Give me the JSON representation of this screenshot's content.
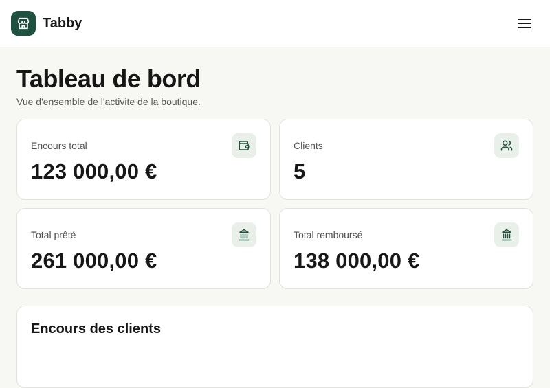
{
  "header": {
    "brand": "Tabby",
    "logo_icon": "store-icon",
    "menu_icon": "hamburger-menu-icon"
  },
  "page": {
    "title": "Tableau de bord",
    "subtitle": "Vue d'ensemble de l'activite de la boutique."
  },
  "stats": [
    {
      "label": "Encours total",
      "value": "123 000,00 €",
      "icon": "wallet-icon"
    },
    {
      "label": "Clients",
      "value": "5",
      "icon": "users-icon"
    },
    {
      "label": "Total prêté",
      "value": "261 000,00 €",
      "icon": "bank-icon"
    },
    {
      "label": "Total remboursé",
      "value": "138 000,00 €",
      "icon": "bank-icon"
    }
  ],
  "section": {
    "title": "Encours des clients"
  },
  "colors": {
    "accent": "#1f5140",
    "icon_bg": "#e9f0ea",
    "background": "#f7f7f3"
  }
}
